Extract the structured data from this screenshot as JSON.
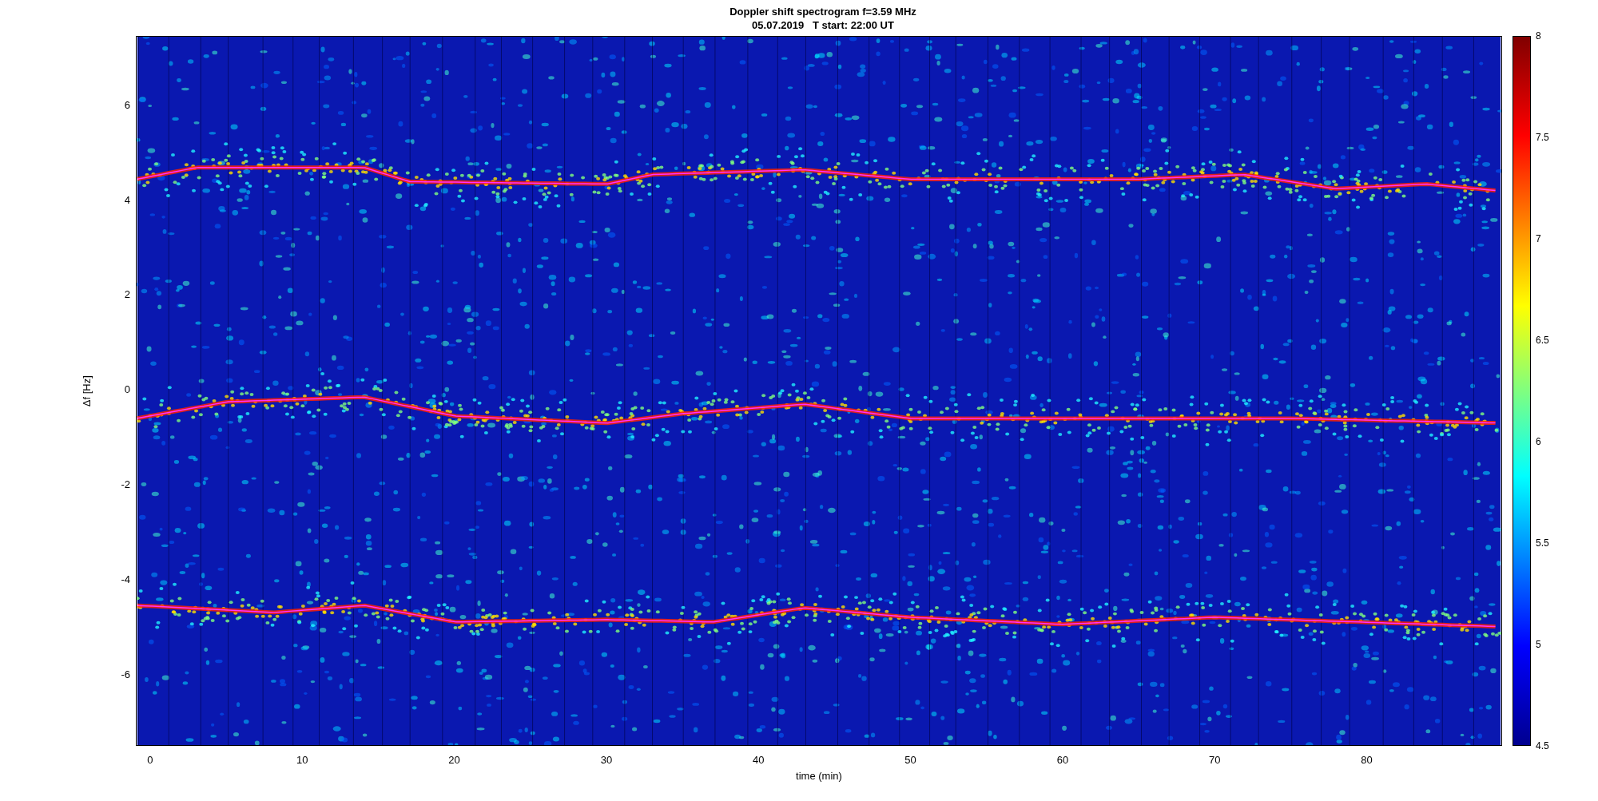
{
  "title": [
    "Doppler shift spectrogram f=3.59 MHz",
    "05.07.2019   T start: 22:00 UT"
  ],
  "ylabel": "Δf [Hz]",
  "xlabel": "time (min)",
  "yticks": [
    "6",
    "4",
    "2",
    "0",
    "-2",
    "-4",
    "-6"
  ],
  "xticks": [
    "0",
    "10",
    "20",
    "30",
    "40",
    "50",
    "60",
    "70",
    "80"
  ],
  "colorbar_ticks": [
    "8",
    "7.5",
    "7",
    "6.5",
    "6",
    "5.5",
    "5",
    "4.5"
  ]
}
